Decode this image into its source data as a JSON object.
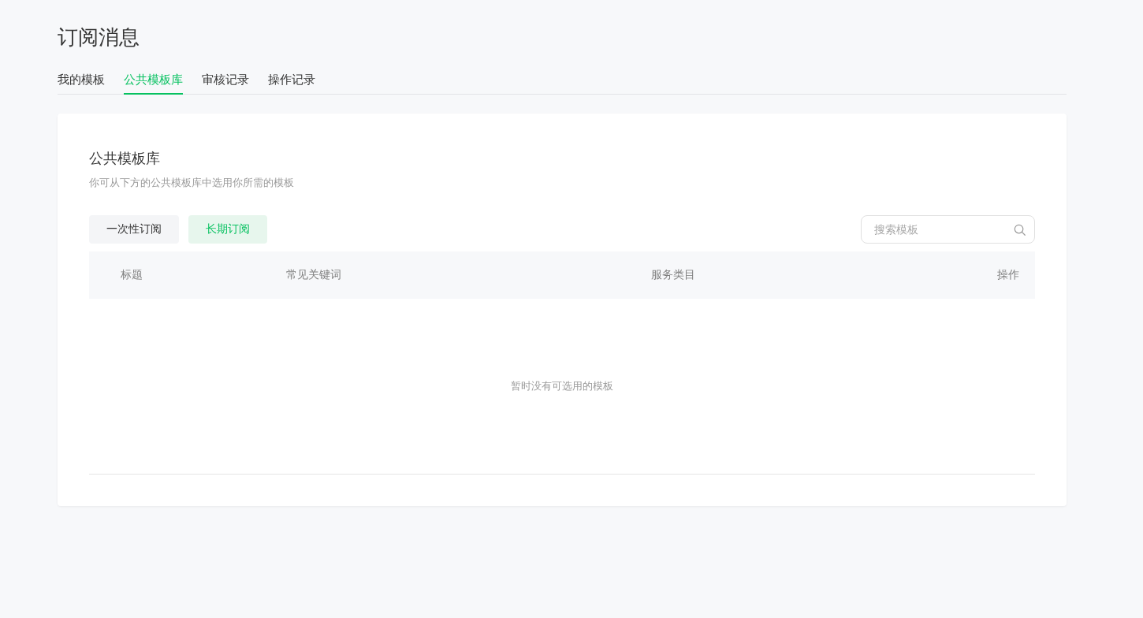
{
  "page": {
    "title": "订阅消息"
  },
  "tabs": [
    {
      "label": "我的模板",
      "selected": false
    },
    {
      "label": "公共模板库",
      "selected": true
    },
    {
      "label": "审核记录",
      "selected": false
    },
    {
      "label": "操作记录",
      "selected": false
    }
  ],
  "panel": {
    "title": "公共模板库",
    "description": "你可从下方的公共模板库中选用你所需的模板",
    "filters": [
      {
        "label": "一次性订阅",
        "selected": false
      },
      {
        "label": "长期订阅",
        "selected": true
      }
    ],
    "search": {
      "placeholder": "搜索模板"
    },
    "table": {
      "columns": [
        "标题",
        "常见关键词",
        "服务类目",
        "操作"
      ],
      "empty_text": "暂时没有可选用的模板"
    }
  }
}
